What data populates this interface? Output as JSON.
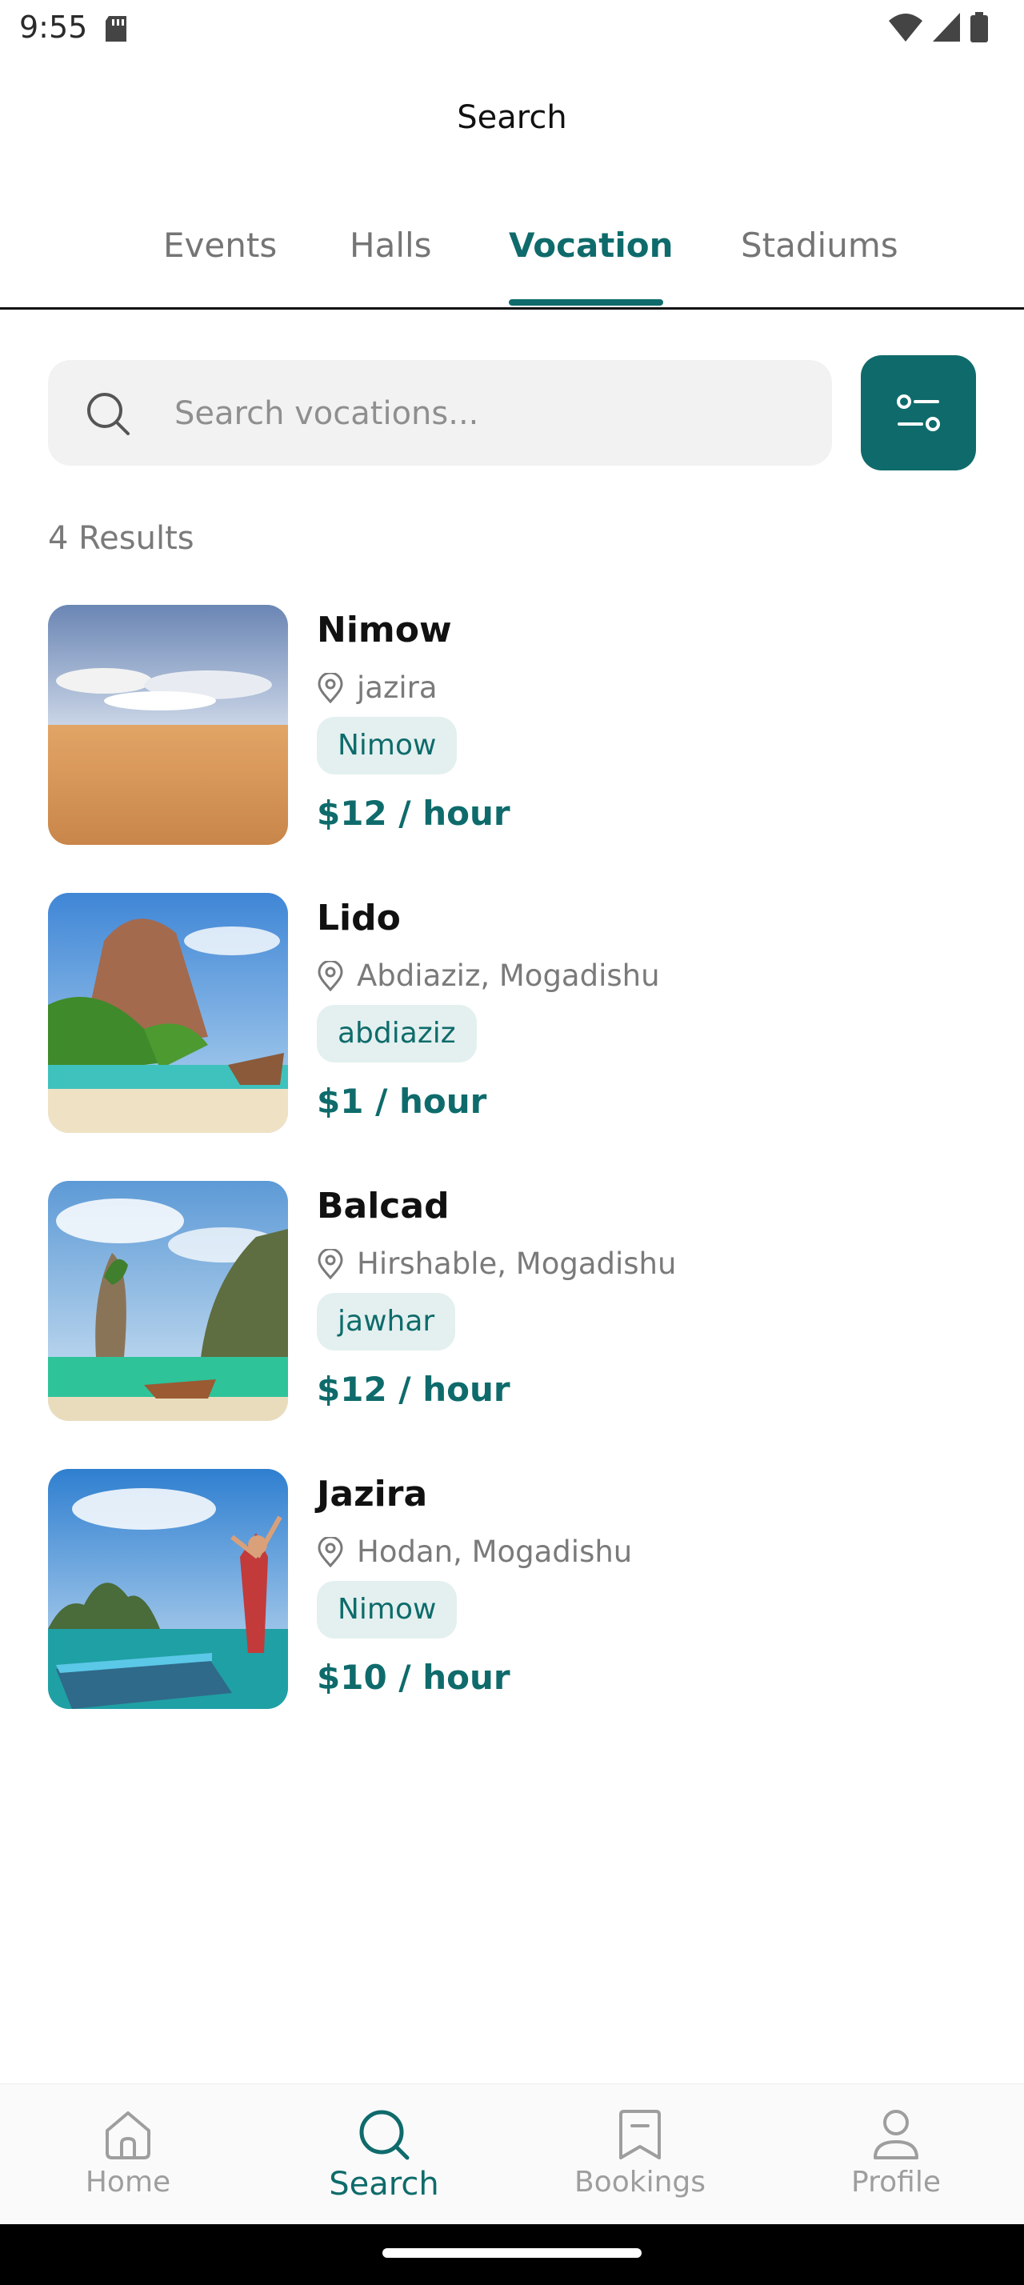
{
  "status_bar": {
    "time": "9:55"
  },
  "app_bar": {
    "title": "Search"
  },
  "tabs": [
    {
      "label": "Events",
      "active": false
    },
    {
      "label": "Halls",
      "active": false
    },
    {
      "label": "Vocation",
      "active": true
    },
    {
      "label": "Stadiums",
      "active": false
    }
  ],
  "search": {
    "placeholder": "Search vocations...",
    "value": ""
  },
  "results": {
    "count_label": "4 Results"
  },
  "items": [
    {
      "name": "Nimow",
      "location": "jazira",
      "tag": "Nimow",
      "price": "$12 / hour",
      "image": "desert-photo"
    },
    {
      "name": "Lido",
      "location": "Abdiaziz, Mogadishu",
      "tag": "abdiaziz",
      "price": "$1 / hour",
      "image": "beach-cliff-photo"
    },
    {
      "name": "Balcad",
      "location": "Hirshable, Mogadishu",
      "tag": "jawhar",
      "price": "$12 / hour",
      "image": "bay-rock-photo"
    },
    {
      "name": "Jazira",
      "location": "Hodan, Mogadishu",
      "tag": "Nimow",
      "price": "$10 / hour",
      "image": "traveler-boat-photo"
    }
  ],
  "bottom_nav": [
    {
      "label": "Home",
      "icon": "home-icon",
      "active": false
    },
    {
      "label": "Search",
      "icon": "search-icon",
      "active": true
    },
    {
      "label": "Bookings",
      "icon": "bookmark-icon",
      "active": false
    },
    {
      "label": "Profile",
      "icon": "person-icon",
      "active": false
    }
  ],
  "colors": {
    "accent": "#0f6b6b",
    "chip_bg": "#e3f0ef",
    "muted": "#7a7a7a"
  }
}
